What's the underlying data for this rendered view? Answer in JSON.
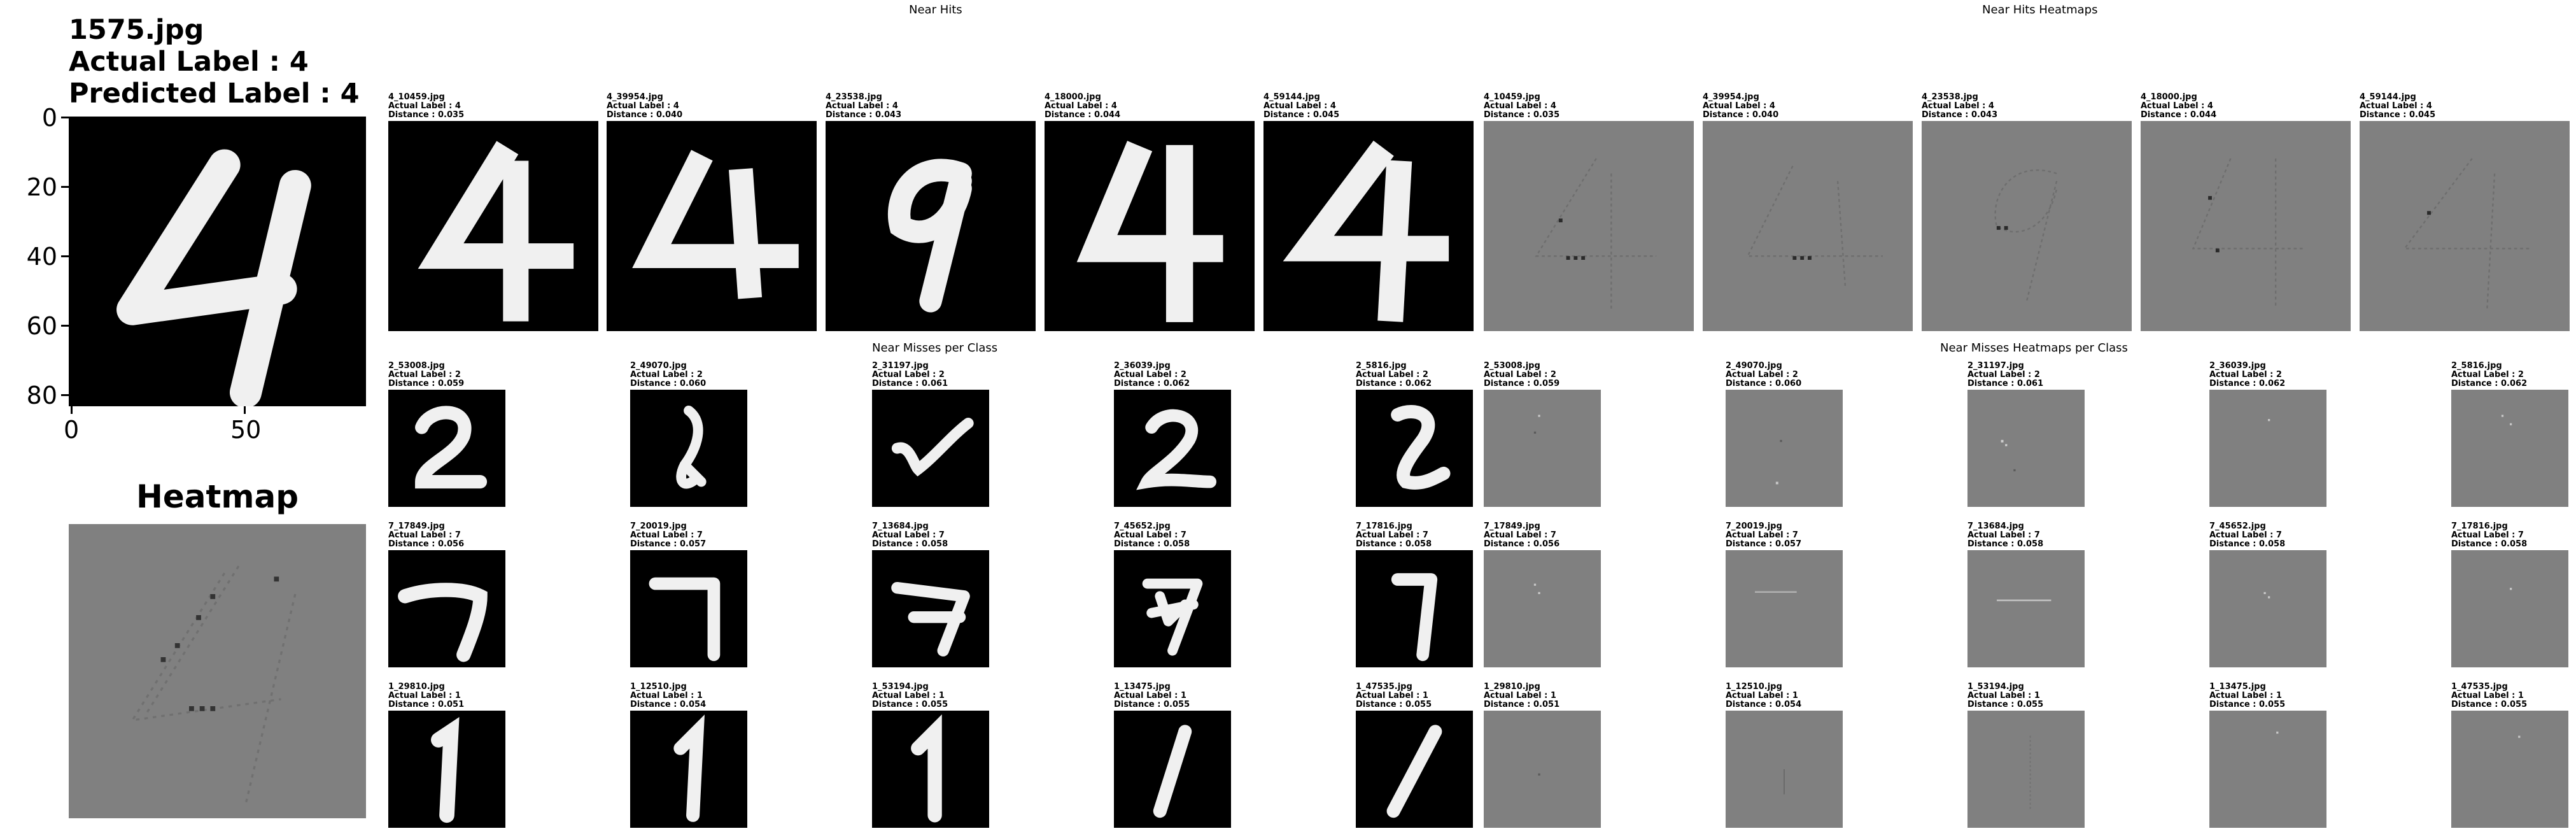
{
  "query": {
    "filename": "1575.jpg",
    "actual": "Actual Label : 4",
    "predicted": "Predicted Label : 4",
    "y_ticks": [
      "0",
      "20",
      "40",
      "60",
      "80"
    ],
    "x_ticks": [
      "0",
      "50"
    ],
    "heatmap_title": "Heatmap"
  },
  "sections": {
    "near_hits": "Near Hits",
    "near_hits_heatmaps": "Near Hits Heatmaps",
    "near_misses": "Near Misses per Class",
    "near_misses_heatmaps": "Near Misses Heatmaps per Class"
  },
  "near_hits": [
    {
      "file": "4_10459.jpg",
      "actual": "Actual Label : 4",
      "distance": "Distance : 0.035",
      "digit": "4"
    },
    {
      "file": "4_39954.jpg",
      "actual": "Actual Label : 4",
      "distance": "Distance : 0.040",
      "digit": "4"
    },
    {
      "file": "4_23538.jpg",
      "actual": "Actual Label : 4",
      "distance": "Distance : 0.043",
      "digit": "4"
    },
    {
      "file": "4_18000.jpg",
      "actual": "Actual Label : 4",
      "distance": "Distance : 0.044",
      "digit": "4"
    },
    {
      "file": "4_59144.jpg",
      "actual": "Actual Label : 4",
      "distance": "Distance : 0.045",
      "digit": "4"
    }
  ],
  "near_misses": [
    [
      {
        "file": "2_53008.jpg",
        "actual": "Actual Label : 2",
        "distance": "Distance : 0.059",
        "digit": "2"
      },
      {
        "file": "2_49070.jpg",
        "actual": "Actual Label : 2",
        "distance": "Distance : 0.060",
        "digit": "2"
      },
      {
        "file": "2_31197.jpg",
        "actual": "Actual Label : 2",
        "distance": "Distance : 0.061",
        "digit": "2"
      },
      {
        "file": "2_36039.jpg",
        "actual": "Actual Label : 2",
        "distance": "Distance : 0.062",
        "digit": "2"
      },
      {
        "file": "2_5816.jpg",
        "actual": "Actual Label : 2",
        "distance": "Distance : 0.062",
        "digit": "2"
      }
    ],
    [
      {
        "file": "7_17849.jpg",
        "actual": "Actual Label : 7",
        "distance": "Distance : 0.056",
        "digit": "7"
      },
      {
        "file": "7_20019.jpg",
        "actual": "Actual Label : 7",
        "distance": "Distance : 0.057",
        "digit": "7"
      },
      {
        "file": "7_13684.jpg",
        "actual": "Actual Label : 7",
        "distance": "Distance : 0.058",
        "digit": "7"
      },
      {
        "file": "7_45652.jpg",
        "actual": "Actual Label : 7",
        "distance": "Distance : 0.058",
        "digit": "7"
      },
      {
        "file": "7_17816.jpg",
        "actual": "Actual Label : 7",
        "distance": "Distance : 0.058",
        "digit": "7"
      }
    ],
    [
      {
        "file": "1_29810.jpg",
        "actual": "Actual Label : 1",
        "distance": "Distance : 0.051",
        "digit": "1"
      },
      {
        "file": "1_12510.jpg",
        "actual": "Actual Label : 1",
        "distance": "Distance : 0.054",
        "digit": "1"
      },
      {
        "file": "1_53194.jpg",
        "actual": "Actual Label : 1",
        "distance": "Distance : 0.055",
        "digit": "1"
      },
      {
        "file": "1_13475.jpg",
        "actual": "Actual Label : 1",
        "distance": "Distance : 0.055",
        "digit": "1"
      },
      {
        "file": "1_47535.jpg",
        "actual": "Actual Label : 1",
        "distance": "Distance : 0.055",
        "digit": "1"
      }
    ]
  ],
  "colors": {
    "image_bg": "#000000",
    "digit": "#f2f2f2",
    "heatmap_bg": "#808080"
  }
}
